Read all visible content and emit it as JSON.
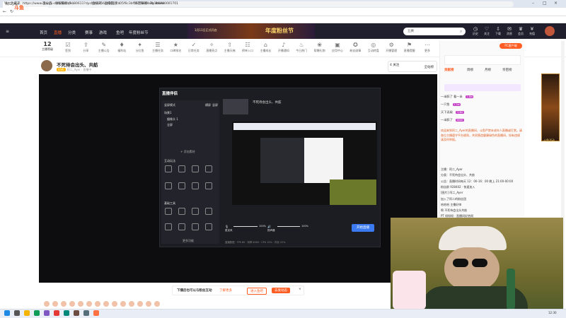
{
  "browser": {
    "tabs": [
      "阿二_Ayer直播_阿二_Ayer直播视频 - 斗鱼",
      "阿二_Ayer直播_阿二...",
      "抖音赚钱 - By 8tone"
    ],
    "url": "https://www.douyu.com/beta/9480611?dyshid=256e416c-7405f6c3bf5675ed9b2b1b6800001701",
    "bookmarks": [
      "导入收藏夹",
      "百分百 · 领取最新小...",
      "直播间 · 直播回放...",
      "抖音赚钱 · By 8tone"
    ]
  },
  "site": {
    "logo": "斗鱼",
    "nav": [
      "首页",
      "直播",
      "分类",
      "赛事",
      "游戏",
      "鱼吧",
      "年度粉丝节"
    ],
    "active_nav": "直播",
    "banner_title": "年度粉丝节",
    "banner_sub": "1月11日正式开启",
    "search_placeholder": "五赛",
    "header_icons": [
      "历史",
      "关注",
      "下载",
      "消息",
      "会员",
      "充值"
    ]
  },
  "toolbar": {
    "level_num": "12",
    "level_label": "主播等级",
    "tools": [
      "签到",
      "分享",
      "主播公告",
      "福利站",
      "分红鱼",
      "主播任务",
      "口碑排名",
      "日常任务",
      "直播亮点",
      "主播天梯",
      "榜单入口",
      "主播成长",
      "开播通知",
      "今日热门",
      "帮赠礼物",
      "应用中心",
      "粉丝勋章",
      "互动转盘",
      "开播管理",
      "直播提醒",
      "更多"
    ]
  },
  "room": {
    "title": "不死待会出头、共舫",
    "meta": "阿二_Ayer · 直播中",
    "follow_count": "4",
    "follow_label": "关注",
    "fans_label": "全站榜"
  },
  "streamer_app": {
    "name": "直播伴侣",
    "mode": "竖屏模式",
    "tabs": [
      "横屏",
      "竖屏"
    ],
    "scene_title": "场景1",
    "scene_item": "摄像头 1",
    "scene_item2": "全屏",
    "add_source": "+ 添加素材",
    "section1": "互动玩法",
    "section2": "基础工具",
    "more_tools": "更多功能",
    "broadcast_title": "不死待会出头、共舫",
    "start_button": "开始直播",
    "mic_label": "麦克风",
    "speaker_label": "扬声器",
    "percent1": "100%",
    "percent2": "100%",
    "footer": "直播数据 · FPS 60 · 码率 8000 · CPU 15% · 内存 22%"
  },
  "tipbar": {
    "text": "下播后也可以与粉丝互动",
    "link": "了解更多",
    "btn1": "进入鱼吧",
    "btn2": "去发动态"
  },
  "right_panel": {
    "pc_button": "PC客户端",
    "tabs": [
      "贡献榜",
      "周榜",
      "月榜",
      "亲密榜"
    ],
    "rank_rows": [
      {
        "name": "一半醉了 看一半",
        "amount": "1.8w"
      },
      {
        "name": "一只鱼",
        "amount": "1.2w"
      },
      {
        "name": "天下无敌",
        "amount": "7280"
      },
      {
        "name": "一半醉了",
        "amount": "3600"
      }
    ],
    "chat_notice": "欢迎来到阿二_Ayer的直播间，斗鱼严禁未成年人直播或打赏。请各位主播遵守平台规则，共同营造健康绿色的直播间，如有违规请及时举报。",
    "chat_lines": [
      "主播：阿二_Ayer",
      "分类：不死待会出头、共舫",
      "公告：直播时间每天 12：00-16：00 晚上 21:00-00:00",
      "粉丝群 928402 · 快速加入",
      "[图片] 阿二_Ayer",
      "加入了阿二的粉丝团",
      "哈哈哈 主播好帅",
      "啊 不死待会出头共舫",
      "PT 呀呀呀 : 直播间好热闹",
      "欢迎 大佬进入直播间"
    ]
  },
  "ad": {
    "label": "斗鱼活动"
  },
  "taskbar": {
    "icons": [
      "windows",
      "search",
      "files",
      "browser",
      "chat",
      "music",
      "video",
      "game",
      "settings",
      "app"
    ],
    "time": "12:30"
  },
  "colors": {
    "accent": "#ff5d23",
    "site_header": "#1f1f2e",
    "app_bg": "#1c1d22",
    "start_btn": "#3b7af0"
  }
}
